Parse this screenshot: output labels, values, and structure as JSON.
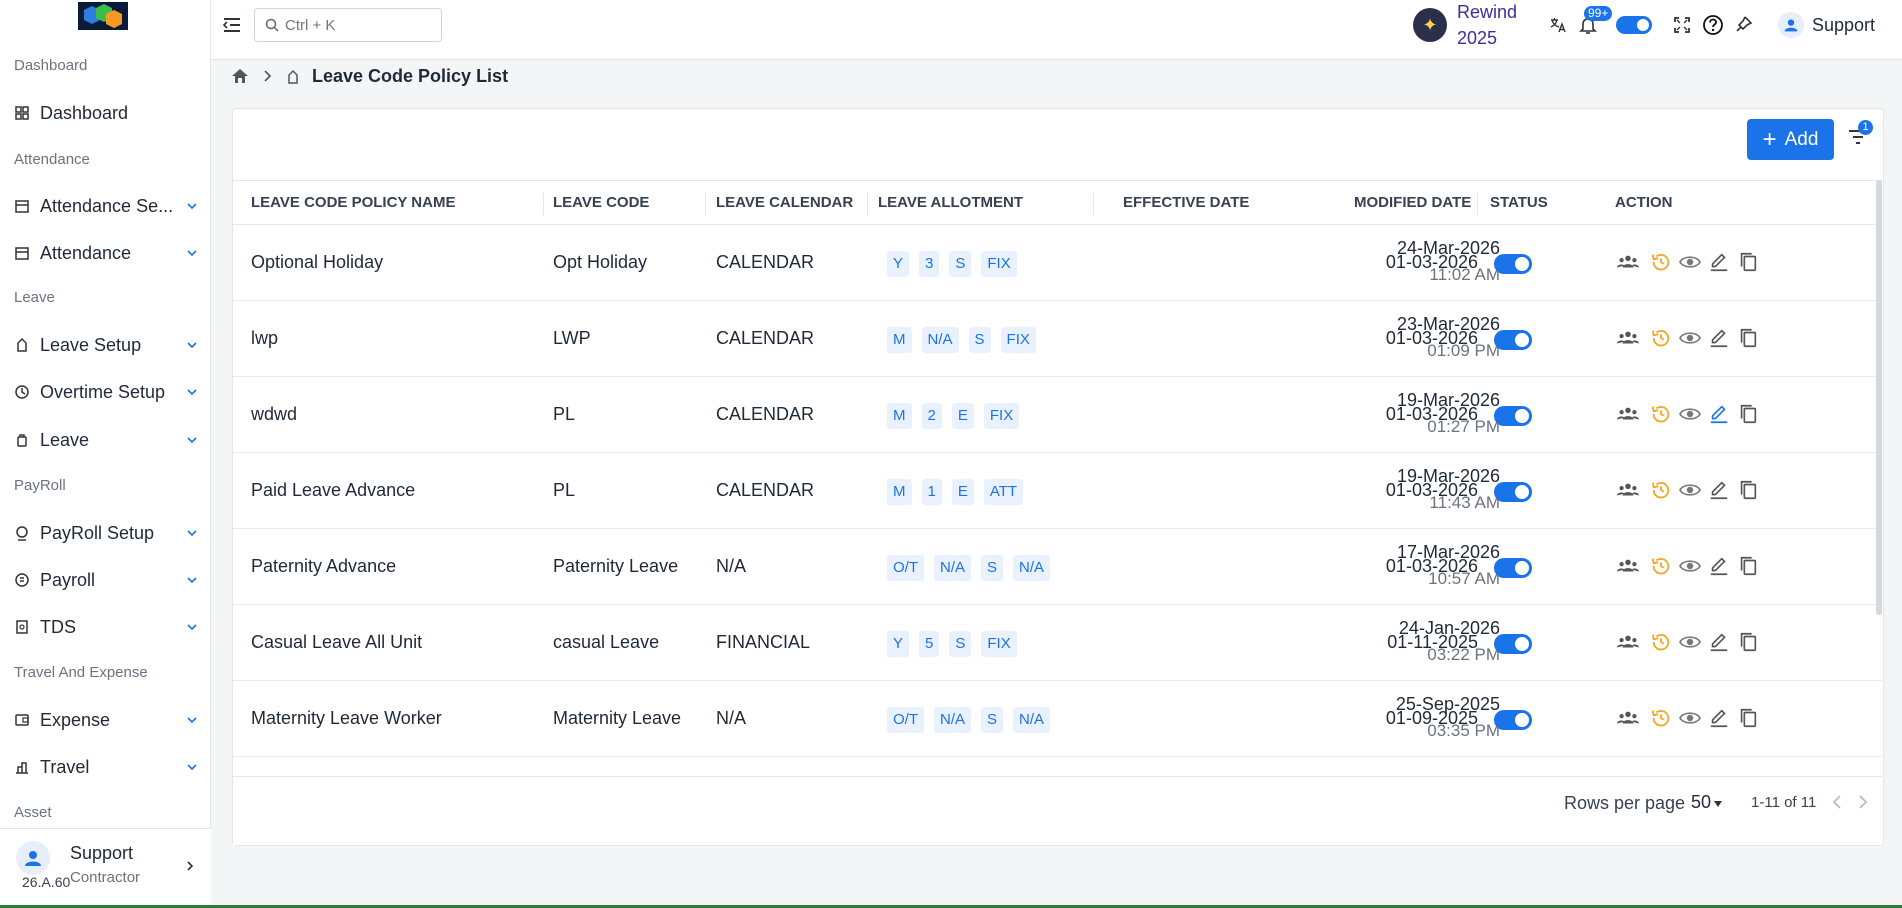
{
  "sidebar": {
    "sections": [
      {
        "label": "Dashboard"
      },
      {
        "label": "Attendance"
      },
      {
        "label": "Leave"
      },
      {
        "label": "PayRoll"
      },
      {
        "label": "Travel And Expense"
      },
      {
        "label": "Asset"
      }
    ],
    "items": [
      {
        "label": "Dashboard",
        "icon": "dashboard-icon"
      },
      {
        "label": "Attendance Se...",
        "icon": "attendance-setup-icon"
      },
      {
        "label": "Attendance",
        "icon": "calendar-icon"
      },
      {
        "label": "Leave Setup",
        "icon": "leave-setup-icon"
      },
      {
        "label": "Overtime Setup",
        "icon": "overtime-icon"
      },
      {
        "label": "Leave",
        "icon": "leave-icon"
      },
      {
        "label": "PayRoll Setup",
        "icon": "payroll-setup-icon"
      },
      {
        "label": "Payroll",
        "icon": "payroll-icon"
      },
      {
        "label": "TDS",
        "icon": "tds-icon"
      },
      {
        "label": "Expense",
        "icon": "expense-icon"
      },
      {
        "label": "Travel",
        "icon": "travel-icon"
      }
    ],
    "user": {
      "name": "Support",
      "role": "Contractor",
      "version": "26.A.60"
    }
  },
  "topbar": {
    "search_placeholder": "Ctrl + K",
    "rewind_line1": "Rewind",
    "rewind_line2": "2025",
    "bell_badge": "99+",
    "user_name": "Support"
  },
  "breadcrumb": {
    "title": "Leave Code Policy List"
  },
  "toolbar": {
    "add_label": "Add",
    "filter_badge": "1"
  },
  "table": {
    "headers": [
      "LEAVE CODE POLICY NAME",
      "LEAVE CODE",
      "LEAVE CALENDAR",
      "LEAVE ALLOTMENT",
      "EFFECTIVE DATE",
      "MODIFIED DATE",
      "STATUS",
      "ACTION"
    ],
    "rows": [
      {
        "name": "Optional Holiday",
        "code": "Opt Holiday",
        "calendar": "CALENDAR",
        "chips": [
          "Y",
          "3",
          "S",
          "FIX"
        ],
        "effective": "01-03-2026",
        "mdate": "24-Mar-2026",
        "mtime": "11:02 AM"
      },
      {
        "name": "lwp",
        "code": "LWP",
        "calendar": "CALENDAR",
        "chips": [
          "M",
          "N/A",
          "S",
          "FIX"
        ],
        "effective": "01-03-2026",
        "mdate": "23-Mar-2026",
        "mtime": "01:09 PM"
      },
      {
        "name": "wdwd",
        "code": "PL",
        "calendar": "CALENDAR",
        "chips": [
          "M",
          "2",
          "E",
          "FIX"
        ],
        "effective": "01-03-2026",
        "mdate": "19-Mar-2026",
        "mtime": "01:27 PM"
      },
      {
        "name": "Paid Leave Advance",
        "code": "PL",
        "calendar": "CALENDAR",
        "chips": [
          "M",
          "1",
          "E",
          "ATT"
        ],
        "effective": "01-03-2026",
        "mdate": "19-Mar-2026",
        "mtime": "11:43 AM"
      },
      {
        "name": "Paternity Advance",
        "code": "Paternity Leave",
        "calendar": "N/A",
        "chips": [
          "O/T",
          "N/A",
          "S",
          "N/A"
        ],
        "effective": "01-03-2026",
        "mdate": "17-Mar-2026",
        "mtime": "10:57 AM"
      },
      {
        "name": "Casual Leave All Unit",
        "code": "casual Leave",
        "calendar": "FINANCIAL",
        "chips": [
          "Y",
          "5",
          "S",
          "FIX"
        ],
        "effective": "01-11-2025",
        "mdate": "24-Jan-2026",
        "mtime": "03:22 PM"
      },
      {
        "name": "Maternity Leave Worker",
        "code": "Maternity Leave",
        "calendar": "N/A",
        "chips": [
          "O/T",
          "N/A",
          "S",
          "N/A"
        ],
        "effective": "01-09-2025",
        "mdate": "25-Sep-2025",
        "mtime": "03:35 PM"
      }
    ]
  },
  "pagination": {
    "rows_label": "Rows per page",
    "rows_value": "50",
    "range": "1-11 of 11"
  },
  "colors": {
    "primary": "#1a73e8",
    "history": "#f5a623",
    "chip_bg": "#e8f1fd"
  }
}
